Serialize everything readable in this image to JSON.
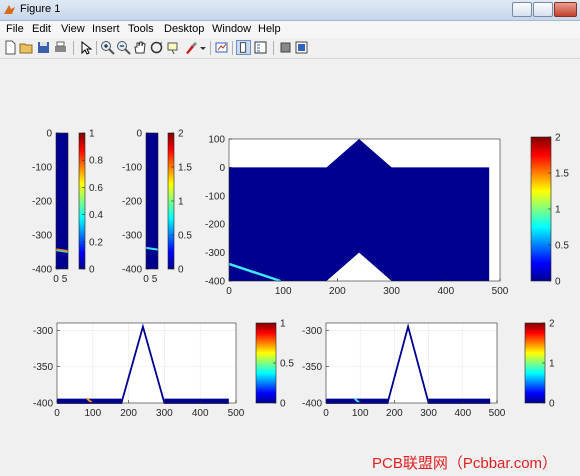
{
  "window": {
    "title": "Figure 1"
  },
  "menu": [
    "File",
    "Edit",
    "View",
    "Insert",
    "Tools",
    "Desktop",
    "Window",
    "Help"
  ],
  "toolbar_icons": [
    "new-figure-icon",
    "open-file-icon",
    "save-icon",
    "print-icon",
    "pointer-icon",
    "zoom-in-icon",
    "zoom-out-icon",
    "pan-hand-icon",
    "rotate-3d-icon",
    "data-cursor-icon",
    "brush-icon",
    "link-plot-icon",
    "colorbar-toggle-icon",
    "legend-toggle-icon",
    "hide-plot-tools-icon",
    "show-plot-tools-icon"
  ],
  "watermark": "PCB联盟网（Pcbbar.com）",
  "colors": {
    "domain_fill": "#00008f",
    "background": "#f0f0f0",
    "axes_bg": "#ffffff"
  },
  "chart_data": [
    {
      "type": "heatmap",
      "name": "narrow-field-1",
      "x_ticks": [
        "0",
        "5"
      ],
      "y_ticks": [
        "0",
        "-100",
        "-200",
        "-300",
        "-400"
      ],
      "ylim": [
        -400,
        0
      ],
      "colorbar": {
        "ticks": [
          "1",
          "0.8",
          "0.6",
          "0.4",
          "0.2",
          "0"
        ],
        "range": [
          0,
          1
        ],
        "colormap": "jet"
      }
    },
    {
      "type": "heatmap",
      "name": "narrow-field-2",
      "x_ticks": [
        "0",
        "5"
      ],
      "y_ticks": [
        "0",
        "-100",
        "-200",
        "-300",
        "-400"
      ],
      "ylim": [
        -400,
        0
      ],
      "colorbar": {
        "ticks": [
          "2",
          "1.5",
          "1",
          "0.5",
          "0"
        ],
        "range": [
          0,
          2
        ],
        "colormap": "jet"
      }
    },
    {
      "type": "heatmap",
      "name": "domain-field",
      "x_ticks": [
        "0",
        "100",
        "200",
        "300",
        "400",
        "500"
      ],
      "y_ticks": [
        "100",
        "0",
        "-100",
        "-200",
        "-300",
        "-400"
      ],
      "xlim": [
        0,
        500
      ],
      "ylim": [
        -400,
        100
      ],
      "domain_outline": {
        "x": [
          0,
          180,
          240,
          300,
          480,
          480,
          300,
          240,
          180,
          0
        ],
        "y": [
          0,
          0,
          100,
          0,
          0,
          -400,
          -400,
          -300,
          -400,
          -400
        ]
      },
      "beam": {
        "x": [
          0,
          95
        ],
        "y": [
          -340,
          -400
        ]
      },
      "colorbar": {
        "ticks": [
          "2",
          "1.5",
          "1",
          "0.5",
          "0"
        ],
        "range": [
          0,
          2
        ],
        "colormap": "jet"
      }
    },
    {
      "type": "line",
      "name": "boundary-profile-1",
      "x_ticks": [
        "0",
        "100",
        "200",
        "300",
        "400",
        "500"
      ],
      "y_ticks": [
        "-300",
        "-350",
        "-400"
      ],
      "xlim": [
        0,
        500
      ],
      "ylim": [
        -400,
        -290
      ],
      "x": [
        0,
        180,
        240,
        300,
        480
      ],
      "y": [
        -400,
        -400,
        -295,
        -400,
        -400
      ],
      "colorbar": {
        "ticks": [
          "1",
          "0.5",
          "0"
        ],
        "range": [
          0,
          1
        ],
        "colormap": "jet"
      }
    },
    {
      "type": "line",
      "name": "boundary-profile-2",
      "x_ticks": [
        "0",
        "100",
        "200",
        "300",
        "400",
        "500"
      ],
      "y_ticks": [
        "-300",
        "-350",
        "-400"
      ],
      "xlim": [
        0,
        500
      ],
      "ylim": [
        -400,
        -290
      ],
      "x": [
        0,
        180,
        240,
        300,
        480
      ],
      "y": [
        -400,
        -400,
        -295,
        -400,
        -400
      ],
      "colorbar": {
        "ticks": [
          "2",
          "1",
          "0"
        ],
        "range": [
          0,
          2
        ],
        "colormap": "jet"
      }
    }
  ]
}
